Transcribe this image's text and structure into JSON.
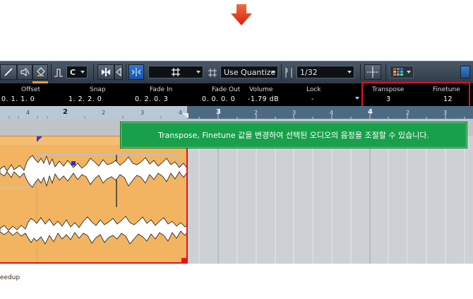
{
  "toolbar": {
    "key_value": "C",
    "quantize_mode": "Use Quantize",
    "quantize_value": "1/32"
  },
  "info_line": {
    "headers": {
      "offset": "Offset",
      "snap": "Snap",
      "fade_in": "Fade In",
      "fade_out": "Fade Out",
      "volume": "Volume",
      "lock": "Lock",
      "transpose": "Transpose",
      "finetune": "Finetune"
    },
    "values": {
      "offset": "0. 1. 1.   0",
      "snap": "1. 2. 2.   0",
      "fade_in": "0. 2. 0.   3",
      "fade_out": "0. 0. 0.   0",
      "volume": "-1.79 dB",
      "lock": "-",
      "transpose": "3",
      "finetune": "12"
    }
  },
  "ruler": {
    "ticks": [
      "4",
      "2",
      "2",
      "3",
      "4",
      "3",
      "2",
      "3",
      "4",
      "4",
      "2",
      "3"
    ]
  },
  "event": {
    "name": "eedup"
  },
  "callout": {
    "text": "Transpose, Finetune 값을 변경하여 선택된 오디오의 음정을 조절할 수 있습니다."
  },
  "colors": {
    "highlight_red": "#e0141c",
    "callout_green": "#18a04a",
    "event_orange": "#f2b460",
    "arrow_red": "#e0301c"
  }
}
